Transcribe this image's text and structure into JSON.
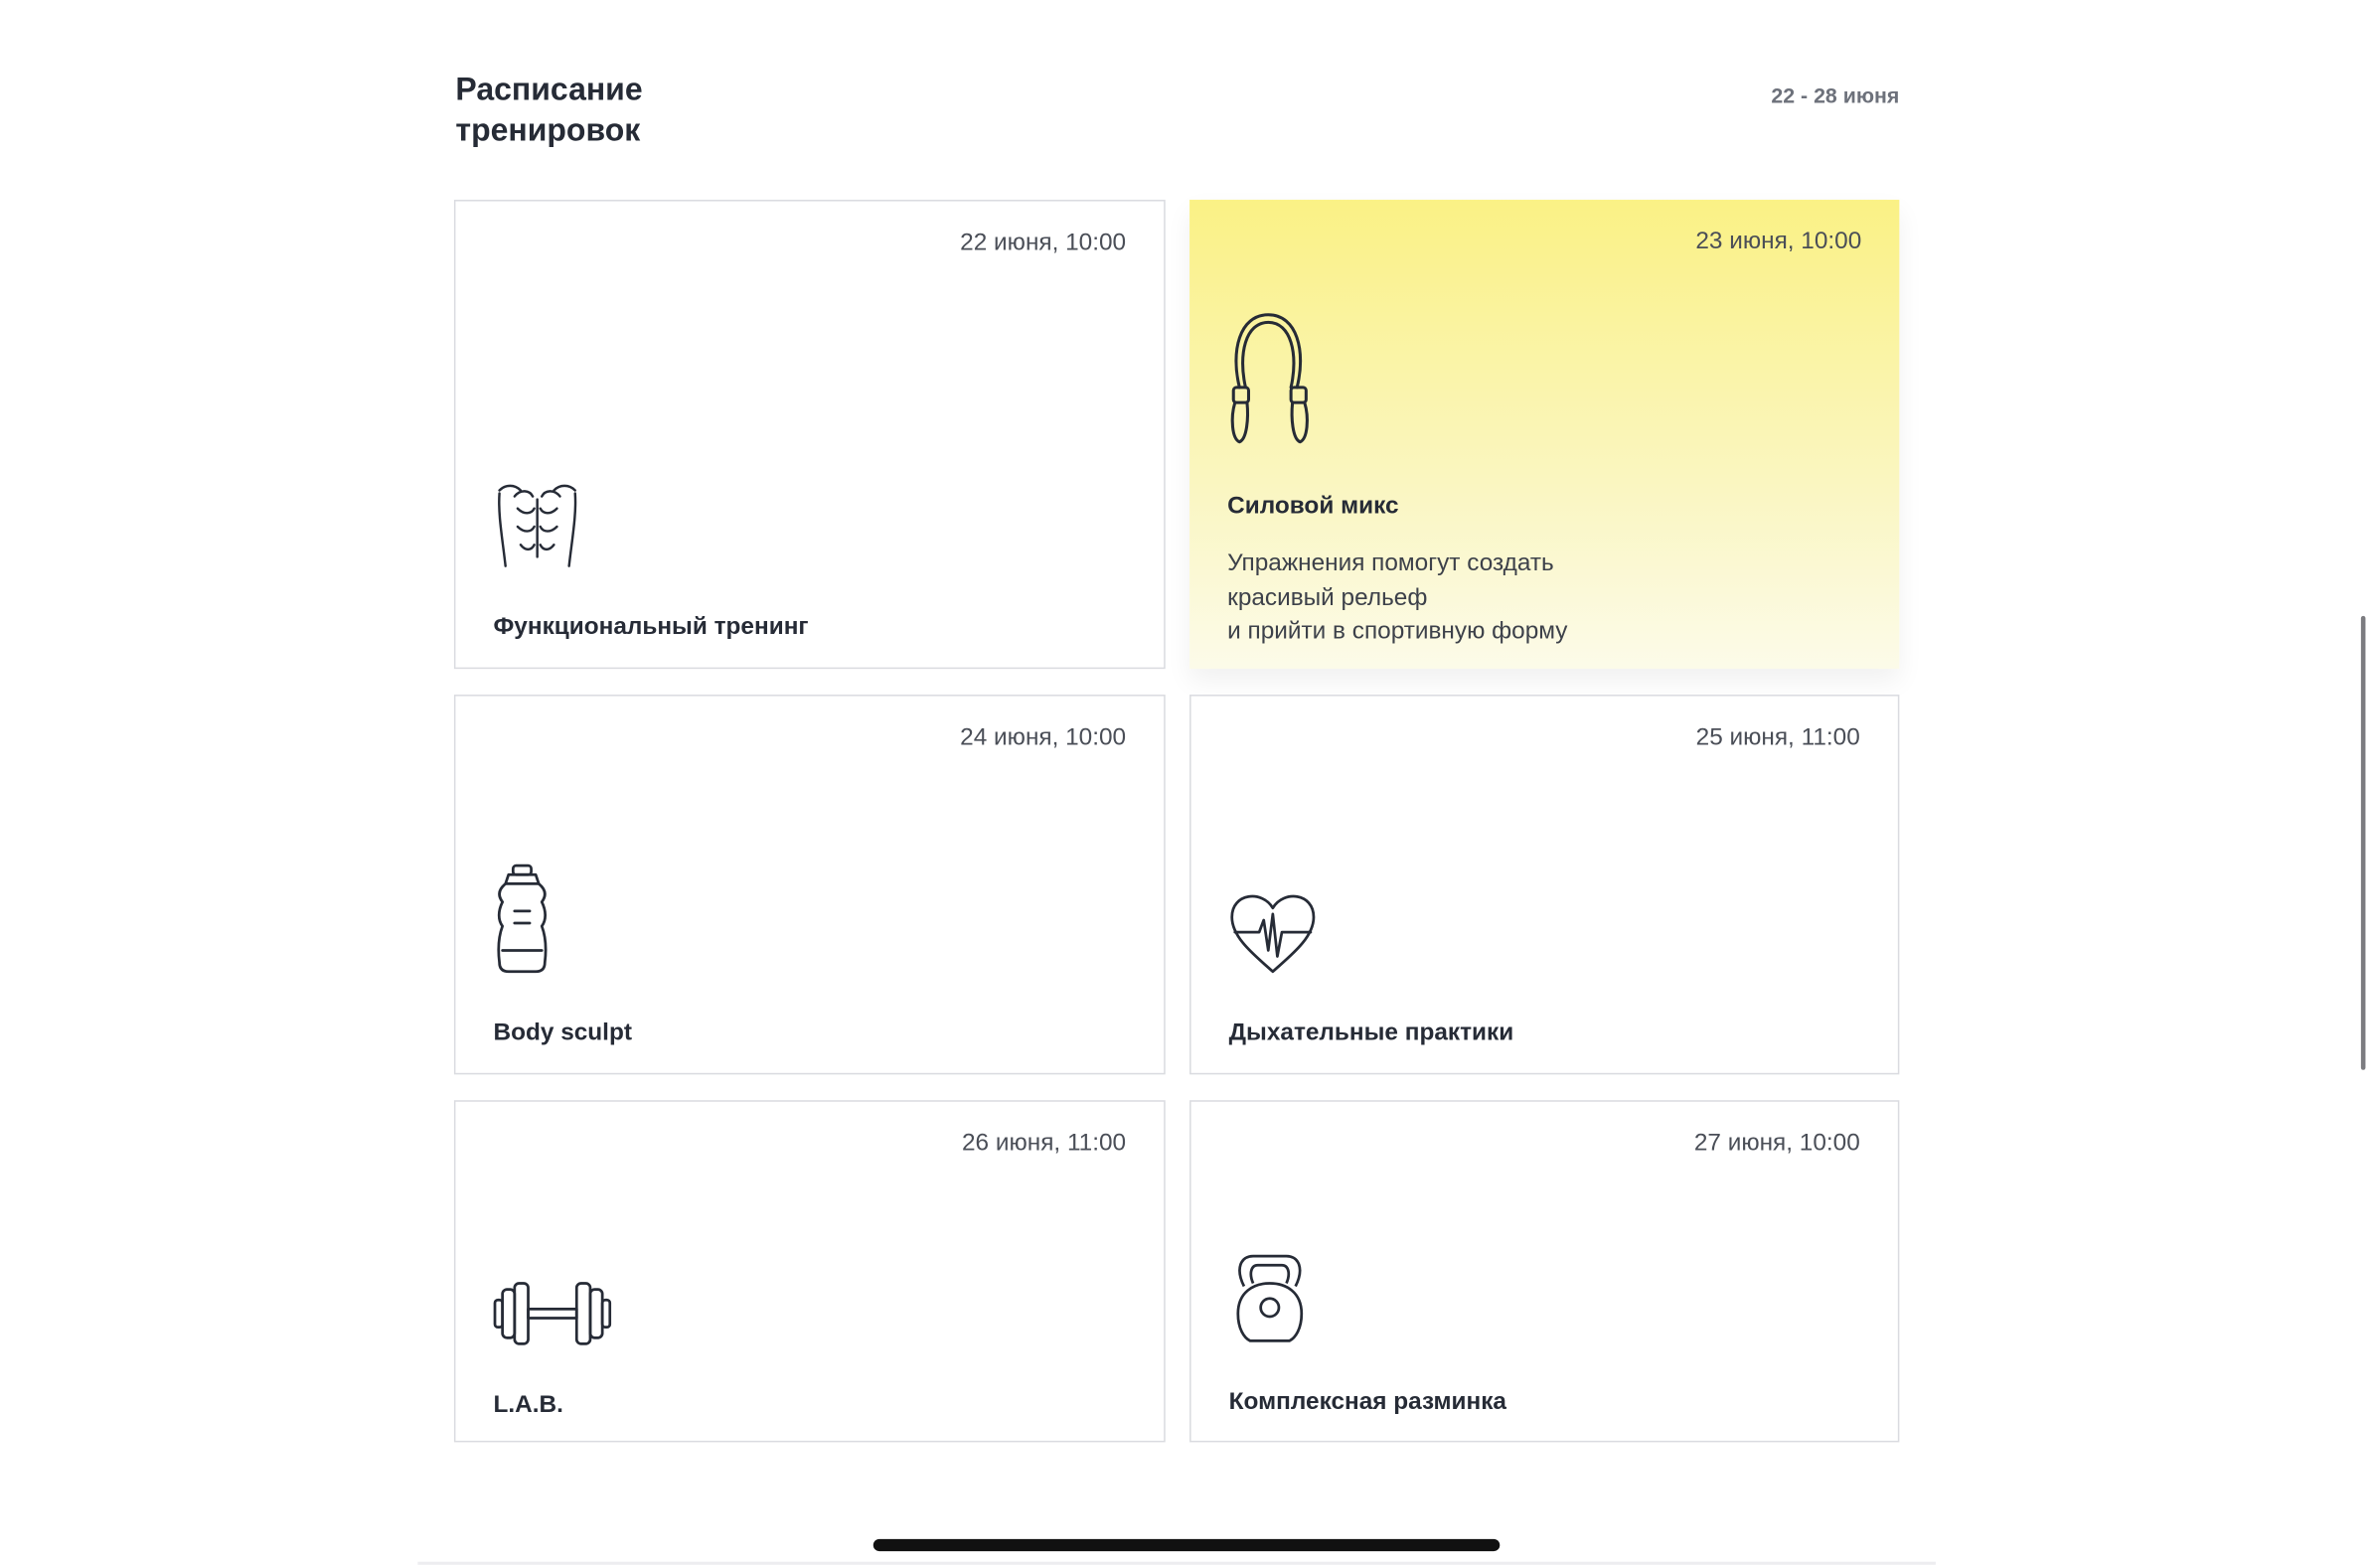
{
  "header": {
    "title": "Расписание\nтренировок",
    "week_range": "22 - 28 июня"
  },
  "cards": [
    {
      "date": "22 июня, 10:00",
      "name": "Функциональный тренинг",
      "icon": "abs-icon"
    },
    {
      "date": "23 июня, 10:00",
      "name": "Силовой микс",
      "icon": "jump-rope-icon",
      "description": "Упражнения помогут создать\nкрасивый рельеф\nи прийти в спортивную форму"
    },
    {
      "date": "24 июня, 10:00",
      "name": "Body sculpt",
      "icon": "water-bottle-icon"
    },
    {
      "date": "25 июня, 11:00",
      "name": "Дыхательные практики",
      "icon": "heart-pulse-icon"
    },
    {
      "date": "26 июня, 11:00",
      "name": "L.A.B.",
      "icon": "dumbbell-icon"
    },
    {
      "date": "27 июня, 10:00",
      "name": "Комплексная разминка",
      "icon": "kettlebell-icon"
    }
  ],
  "colors": {
    "highlight_top": "#faf185",
    "highlight_bottom": "#fcfbe9",
    "text_primary": "#262b36",
    "border": "#dadbe0"
  }
}
